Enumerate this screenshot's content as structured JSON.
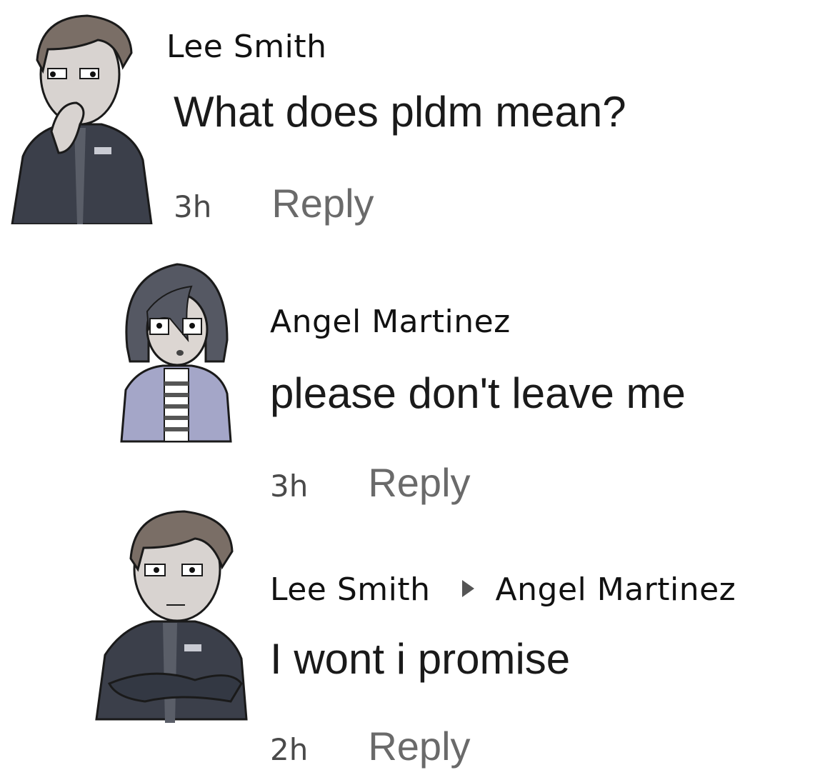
{
  "comments": [
    {
      "author": "Lee Smith",
      "text": "What does pldm mean?",
      "time": "3h",
      "reply_label": "Reply"
    },
    {
      "author": "Angel Martinez",
      "text": "please don't leave me",
      "time": "3h",
      "reply_label": "Reply"
    },
    {
      "author": "Lee Smith",
      "reply_to": "Angel Martinez",
      "text": "I wont i promise",
      "time": "2h",
      "reply_label": "Reply"
    }
  ],
  "colors": {
    "background": "#ffffff",
    "text": "#111111",
    "meta": "#6f6f6f",
    "jacket": "#3b3f4a",
    "hoodie": "#a4a6c8"
  }
}
